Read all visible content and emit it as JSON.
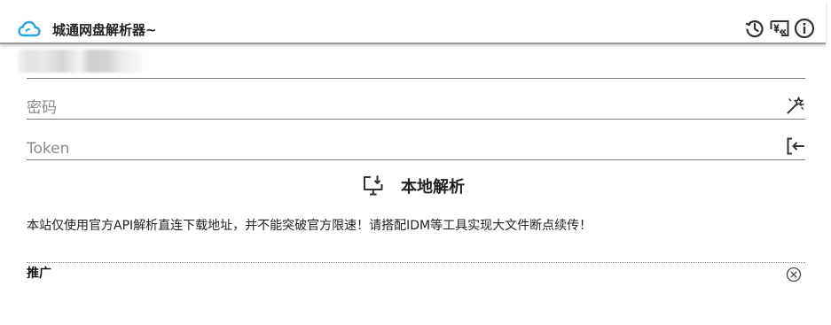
{
  "header": {
    "title": "城通网盘解析器~",
    "icons": [
      "cloud-icon",
      "history-icon",
      "donate-icon",
      "info-icon"
    ]
  },
  "form": {
    "password": {
      "placeholder": "密码",
      "value": ""
    },
    "token": {
      "placeholder": "Token",
      "value": ""
    },
    "icons": [
      "magic-wand-icon",
      "login-icon"
    ]
  },
  "local_parse": {
    "label": "本地解析",
    "icon": "download-monitor-icon"
  },
  "notice": "本站仅使用官方API解析直连下载地址，并不能突破官方限速！请搭配IDM等工具实现大文件断点续传！",
  "promo": {
    "label": "推广",
    "close_icon": "close-circle-icon"
  },
  "colors": {
    "accent": "#29a8e0",
    "icon": "#333333",
    "line": "#7a7a7a"
  }
}
